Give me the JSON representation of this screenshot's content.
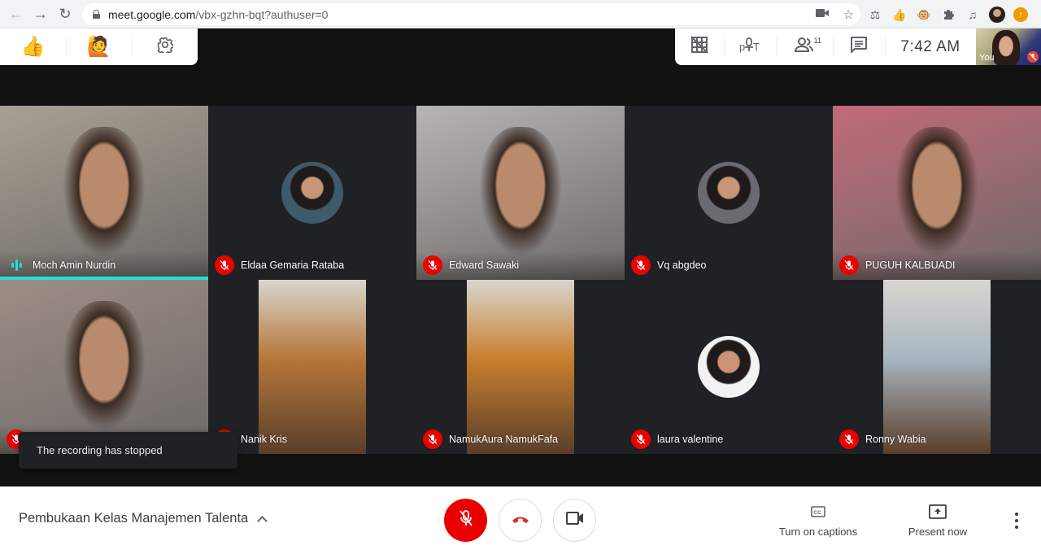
{
  "browser": {
    "url_host": "meet.google.com",
    "url_path": "/vbx-gzhn-bqt?authuser=0",
    "nav": [
      "back-icon",
      "forward-icon",
      "reload-icon"
    ],
    "omnibox_icons": [
      "camera-icon",
      "bookmark-star-icon"
    ],
    "extensions": [
      "extension-icon",
      "thumbs-up-extension-icon",
      "monkey-extension-icon",
      "puzzle-extensions-icon",
      "media-queue-icon",
      "profile-avatar",
      "update-icon"
    ]
  },
  "reactions": {
    "items": [
      {
        "name": "thumbs-up-icon",
        "glyph": "👍"
      },
      {
        "name": "raise-hand-icon",
        "glyph": "🙋"
      },
      {
        "name": "settings-gear-icon",
        "glyph": "⚙"
      }
    ]
  },
  "info_panel": {
    "participant_count": "11",
    "time": "7:42  AM"
  },
  "self_view": {
    "label": "You",
    "muted": true
  },
  "participants": [
    {
      "name": "Moch Amin Nurdin",
      "type": "video",
      "muted": false,
      "speaking": true,
      "bg": "#a9a094"
    },
    {
      "name": "Eldaa Gemaria Rataba",
      "type": "avatar",
      "muted": true,
      "avatar_color": "#3f5b6b"
    },
    {
      "name": "Edward Sawaki",
      "type": "video",
      "muted": true,
      "bg": "#b7b4b6"
    },
    {
      "name": "Vq abgdeo",
      "type": "avatar",
      "muted": true,
      "avatar_color": "#6b6a72"
    },
    {
      "name": "PUGUH KALBUADI",
      "type": "video",
      "muted": true,
      "bg": "#c36a7a"
    },
    {
      "name": "",
      "type": "video",
      "muted": true,
      "bg": "#9c8d86"
    },
    {
      "name": "Nanik Kris",
      "type": "portrait",
      "muted": true,
      "bg": "#b7773a"
    },
    {
      "name": "NamukAura NamukFafa",
      "type": "portrait",
      "muted": true,
      "bg": "#c9802f"
    },
    {
      "name": "laura valentine",
      "type": "avatar",
      "muted": true,
      "avatar_color": "#f2f2f2"
    },
    {
      "name": "Ronny Wabia",
      "type": "portrait",
      "muted": true,
      "bg": "#a8b5c0"
    }
  ],
  "toast": {
    "message": "The recording has stopped"
  },
  "bottom_bar": {
    "meeting_title": "Pembukaan Kelas Manajemen Talenta",
    "captions_label": "Turn on captions",
    "present_label": "Present now",
    "mic_state": "muted"
  },
  "colors": {
    "mute_red": "#ea0000",
    "speaking_teal": "#26e0d1",
    "hangup_red": "#d93025"
  }
}
